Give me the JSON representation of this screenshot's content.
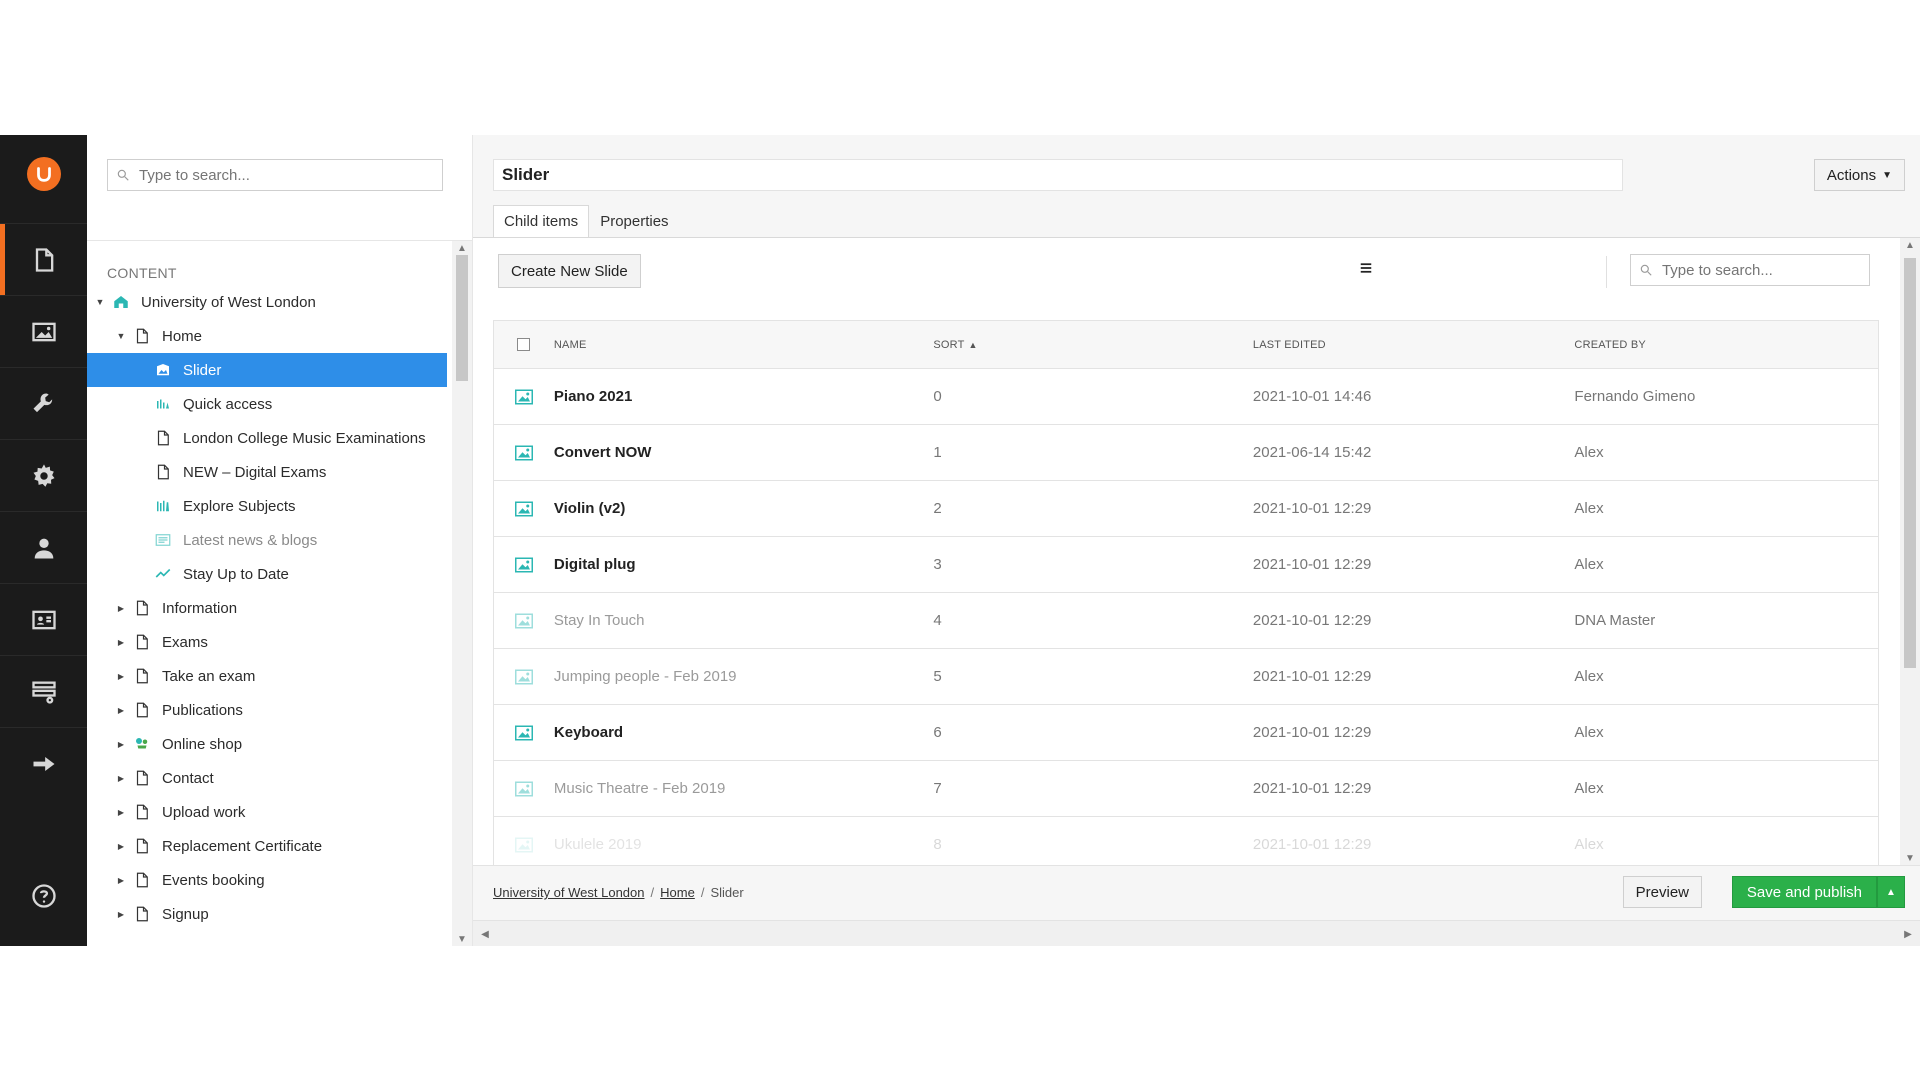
{
  "tree": {
    "search_placeholder": "Type to search...",
    "section_title": "CONTENT",
    "items": [
      {
        "label": "University of West London",
        "indent": 0,
        "caret": "down",
        "icon": "home-icon"
      },
      {
        "label": "Home",
        "indent": 1,
        "caret": "down",
        "icon": "page-icon"
      },
      {
        "label": "Slider",
        "indent": 2,
        "caret": "",
        "icon": "slider-icon",
        "selected": true
      },
      {
        "label": "Quick access",
        "indent": 2,
        "caret": "",
        "icon": "quick-access-icon"
      },
      {
        "label": "London College Music Examinations",
        "indent": 2,
        "caret": "",
        "icon": "page-icon"
      },
      {
        "label": "NEW – Digital Exams",
        "indent": 2,
        "caret": "",
        "icon": "page-icon"
      },
      {
        "label": "Explore Subjects",
        "indent": 2,
        "caret": "",
        "icon": "books-icon"
      },
      {
        "label": "Latest news & blogs",
        "indent": 2,
        "caret": "",
        "icon": "news-icon",
        "dim": true
      },
      {
        "label": "Stay Up to Date",
        "indent": 2,
        "caret": "",
        "icon": "trend-icon"
      },
      {
        "label": "Information",
        "indent": 1,
        "caret": "right",
        "icon": "page-icon"
      },
      {
        "label": "Exams",
        "indent": 1,
        "caret": "right",
        "icon": "page-icon"
      },
      {
        "label": "Take an exam",
        "indent": 1,
        "caret": "right",
        "icon": "page-icon"
      },
      {
        "label": "Publications",
        "indent": 1,
        "caret": "right",
        "icon": "page-icon"
      },
      {
        "label": "Online shop",
        "indent": 1,
        "caret": "right",
        "icon": "shop-icon"
      },
      {
        "label": "Contact",
        "indent": 1,
        "caret": "right",
        "icon": "page-icon"
      },
      {
        "label": "Upload work",
        "indent": 1,
        "caret": "right",
        "icon": "page-icon"
      },
      {
        "label": "Replacement Certificate",
        "indent": 1,
        "caret": "right",
        "icon": "page-icon"
      },
      {
        "label": "Events booking",
        "indent": 1,
        "caret": "right",
        "icon": "page-icon"
      },
      {
        "label": "Signup",
        "indent": 1,
        "caret": "right",
        "icon": "page-icon"
      }
    ]
  },
  "header": {
    "title": "Slider",
    "actions_label": "Actions"
  },
  "tabs": [
    {
      "label": "Child items",
      "active": true
    },
    {
      "label": "Properties",
      "active": false
    }
  ],
  "toolbar": {
    "create_label": "Create New Slide",
    "search_placeholder": "Type to search..."
  },
  "table": {
    "headers": {
      "name": "NAME",
      "sort": "SORT",
      "last_edited": "LAST EDITED",
      "created_by": "CREATED BY"
    },
    "rows": [
      {
        "name": "Piano 2021",
        "sort": "0",
        "last_edited": "2021-10-01 14:46",
        "created_by": "Fernando Gimeno",
        "dim": false
      },
      {
        "name": "Convert NOW",
        "sort": "1",
        "last_edited": "2021-06-14 15:42",
        "created_by": "Alex",
        "dim": false
      },
      {
        "name": "Violin (v2)",
        "sort": "2",
        "last_edited": "2021-10-01 12:29",
        "created_by": "Alex",
        "dim": false
      },
      {
        "name": "Digital plug",
        "sort": "3",
        "last_edited": "2021-10-01 12:29",
        "created_by": "Alex",
        "dim": false
      },
      {
        "name": "Stay In Touch",
        "sort": "4",
        "last_edited": "2021-10-01 12:29",
        "created_by": "DNA Master",
        "dim": true
      },
      {
        "name": "Jumping people - Feb 2019",
        "sort": "5",
        "last_edited": "2021-10-01 12:29",
        "created_by": "Alex",
        "dim": true
      },
      {
        "name": "Keyboard",
        "sort": "6",
        "last_edited": "2021-10-01 12:29",
        "created_by": "Alex",
        "dim": false
      },
      {
        "name": "Music Theatre - Feb 2019",
        "sort": "7",
        "last_edited": "2021-10-01 12:29",
        "created_by": "Alex",
        "dim": true
      },
      {
        "name": "Ukulele 2019",
        "sort": "8",
        "last_edited": "2021-10-01 12:29",
        "created_by": "Alex",
        "dim": true,
        "partial": true
      }
    ]
  },
  "footer": {
    "breadcrumb": [
      "University of West London",
      "Home",
      "Slider"
    ],
    "preview_label": "Preview",
    "publish_label": "Save and publish"
  },
  "colors": {
    "accent_orange": "#f36f21",
    "selected_blue": "#2e8ee8",
    "publish_green": "#2bb04a",
    "icon_teal": "#2bb7b3",
    "rail_bg": "#1b1b1b"
  }
}
